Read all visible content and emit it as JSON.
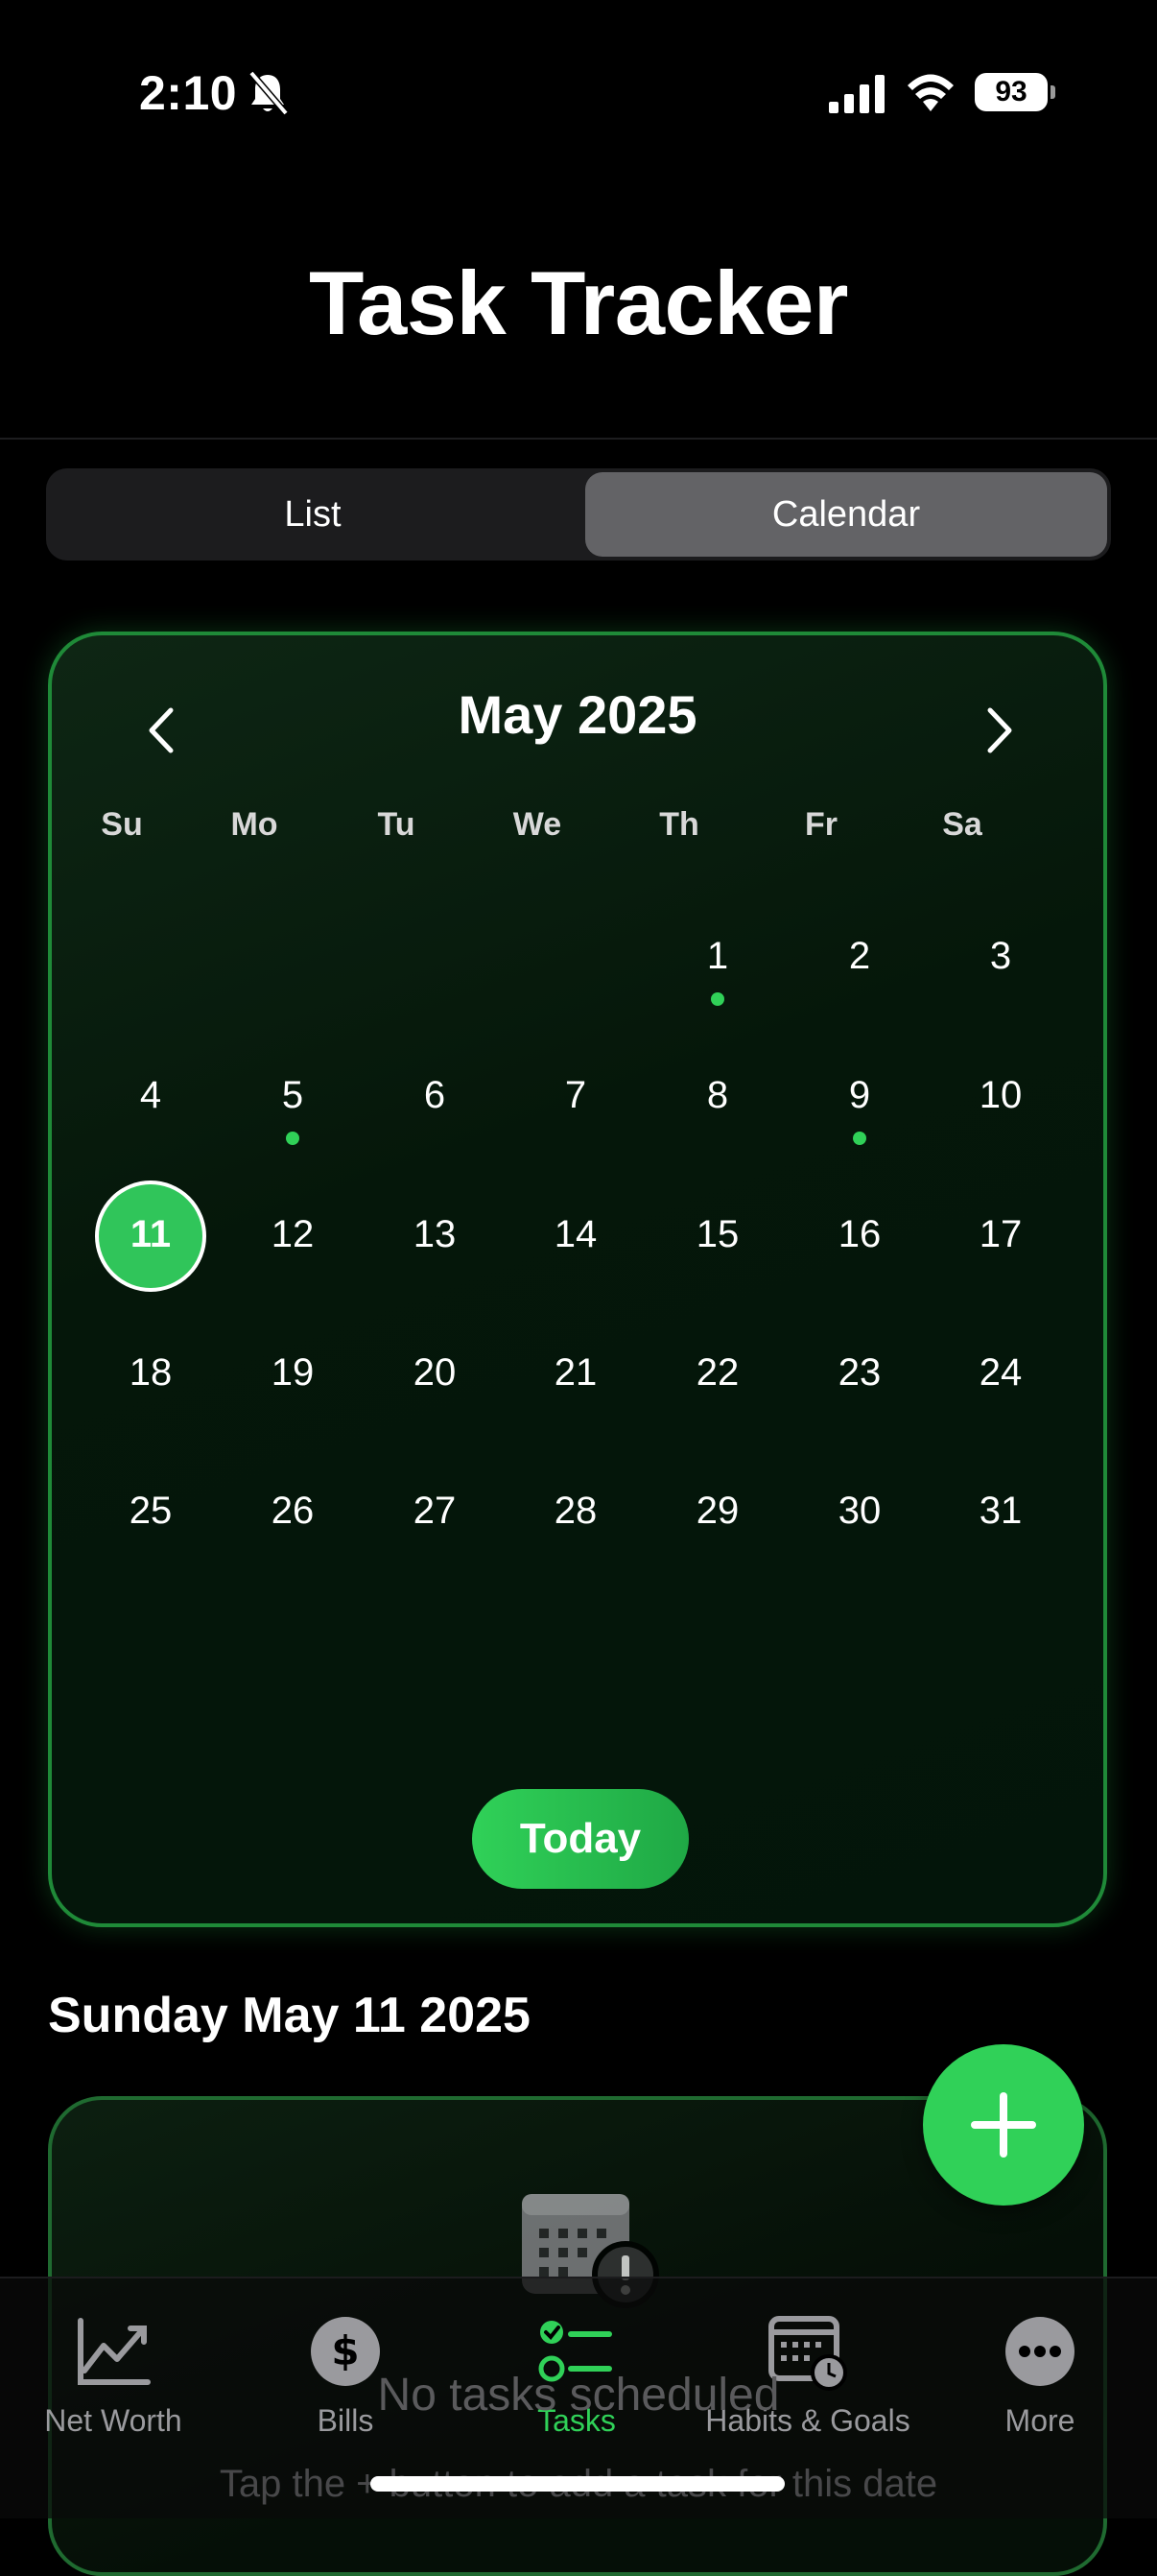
{
  "status_bar": {
    "time": "2:10",
    "battery": "93"
  },
  "header": {
    "title": "Task Tracker"
  },
  "view_toggle": {
    "list_label": "List",
    "calendar_label": "Calendar",
    "selected": "Calendar"
  },
  "calendar": {
    "month_title": "May 2025",
    "weekdays": [
      "Su",
      "Mo",
      "Tu",
      "We",
      "Th",
      "Fr",
      "Sa"
    ],
    "weeks": [
      [
        "",
        "",
        "",
        "",
        "1",
        "2",
        "3"
      ],
      [
        "4",
        "5",
        "6",
        "7",
        "8",
        "9",
        "10"
      ],
      [
        "11",
        "12",
        "13",
        "14",
        "15",
        "16",
        "17"
      ],
      [
        "18",
        "19",
        "20",
        "21",
        "22",
        "23",
        "24"
      ],
      [
        "25",
        "26",
        "27",
        "28",
        "29",
        "30",
        "31"
      ]
    ],
    "selected_day": "11",
    "days_with_tasks": [
      "1",
      "5",
      "9"
    ],
    "today_button": "Today"
  },
  "selected_date": {
    "heading": "Sunday May 11 2025"
  },
  "empty_state": {
    "title": "No tasks scheduled",
    "subtitle": "Tap the + button to add a task for this date"
  },
  "tab_bar": {
    "items": [
      {
        "label": "Net Worth",
        "icon": "chart-line-icon"
      },
      {
        "label": "Bills",
        "icon": "dollar-circle-icon"
      },
      {
        "label": "Tasks",
        "icon": "checklist-icon"
      },
      {
        "label": "Habits & Goals",
        "icon": "calendar-clock-icon"
      },
      {
        "label": "More",
        "icon": "ellipsis-circle-icon"
      }
    ],
    "active": "Tasks"
  },
  "colors": {
    "accent": "#30d158",
    "background": "#000000",
    "segment_selected": "#636366"
  }
}
